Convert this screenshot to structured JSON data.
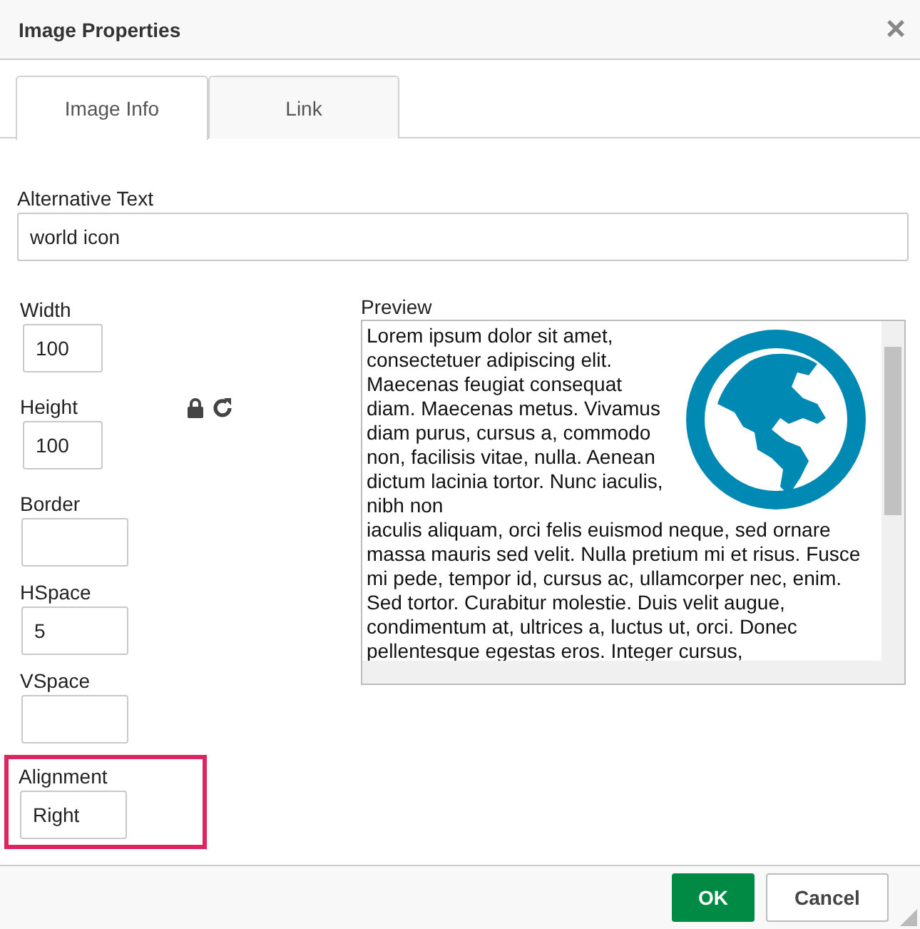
{
  "window": {
    "title": "Image Properties",
    "close": "×"
  },
  "tabs": [
    {
      "label": "Image Info",
      "selected": true
    },
    {
      "label": "Link",
      "selected": false
    }
  ],
  "alt_text": {
    "label": "Alternative Text",
    "value": "world icon"
  },
  "fields": [
    {
      "label": "Width",
      "value": "100",
      "highlighted": false
    },
    {
      "label": "Height",
      "value": "100",
      "highlighted": false
    },
    {
      "label": "Border",
      "highlighted": false
    },
    {
      "label": "HSpace",
      "value": "5",
      "highlighted": false
    },
    {
      "label": "VSpace",
      "highlighted": false
    },
    {
      "label": "Alignment",
      "value": "Right",
      "highlighted": true
    }
  ],
  "preview": {
    "label": "Preview",
    "text_beside_image": "Lorem ipsum dolor sit amet, consectetuer adipiscing elit. Maecenas feugiat consequat diam. Maecenas metus. Vivamus diam purus, cursus a, commodo non, facilisis vitae, nulla. Aenean dictum lacinia tortor. Nunc iaculis, nibh non",
    "text_below_image": "iaculis aliquam, orci felis euismod neque, sed ornare massa mauris sed velit. Nulla pretium mi et risus. Fusce mi pede, tempor id, cursus ac, ullamcorper nec, enim. Sed tortor. Curabitur molestie. Duis velit augue, condimentum at, ultrices a, luctus ut, orci. Donec pellentesque egestas eros. Integer cursus,"
  },
  "buttons": [
    {
      "label": "OK",
      "kind": "primary"
    },
    {
      "label": "Cancel",
      "kind": "secondary"
    }
  ]
}
